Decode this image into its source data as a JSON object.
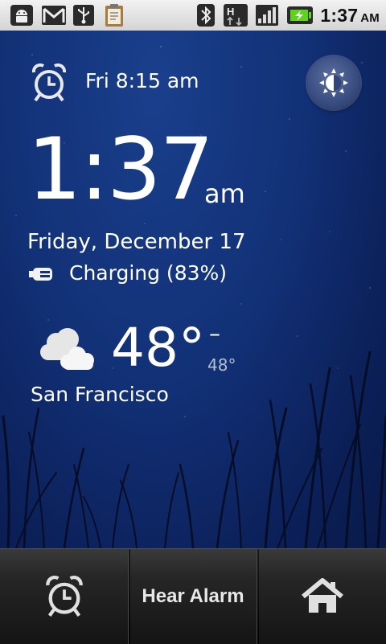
{
  "status_bar": {
    "time": "1:37",
    "ampm": "AM",
    "left_icons": [
      "android-debug-icon",
      "gmail-icon",
      "usb-icon",
      "clipboard-icon"
    ],
    "right_icons": [
      "bluetooth-icon",
      "hspa-data-icon",
      "signal-icon",
      "battery-charging-icon"
    ]
  },
  "alarm": {
    "next": "Fri 8:15 am"
  },
  "clock": {
    "time": "1:37",
    "ampm": "am",
    "date": "Friday, December 17",
    "charging": "Charging (83%)"
  },
  "weather": {
    "temp": "48°",
    "dash": "–",
    "low": "48°",
    "city": "San Francisco",
    "condition_icon": "partly-cloudy-icon"
  },
  "bottom_bar": {
    "hear_alarm": "Hear Alarm"
  },
  "colors": {
    "background": "#123177",
    "text": "#ffffff",
    "bottom_bar": "#262626"
  }
}
